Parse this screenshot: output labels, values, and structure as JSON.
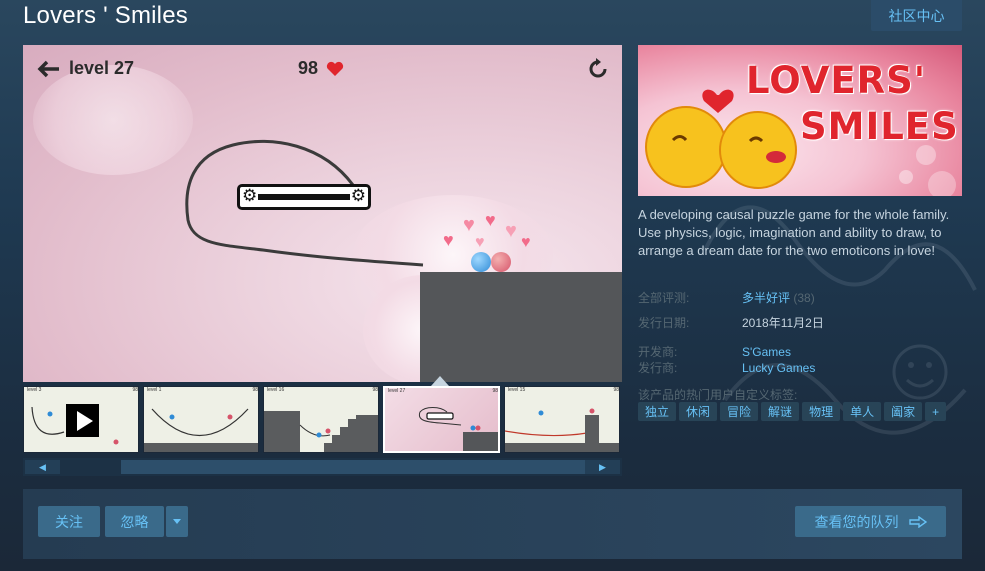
{
  "app": {
    "title": "Lovers ' Smiles",
    "community_hub": "社区中心"
  },
  "media": {
    "level_label": "level 27",
    "lives": "98",
    "thumb_labels": [
      "level 3",
      "level 1",
      "level 16",
      "level 27",
      "level 15"
    ],
    "thumb_lives": "98"
  },
  "capsule": {
    "line1": "LOVERS'",
    "line2": "SMILES"
  },
  "description": "A developing causal puzzle game for the whole family. Use physics, logic, imagination and ability to draw, to arrange a dream date for the two emoticons in love!",
  "reviews": {
    "label": "全部评测:",
    "summary": "多半好评",
    "count": "(38)"
  },
  "release": {
    "label": "发行日期:",
    "date": "2018年11月2日"
  },
  "developer": {
    "label": "开发商:",
    "name": "S'Games"
  },
  "publisher": {
    "label": "发行商:",
    "name": "Lucky Games"
  },
  "tags": {
    "label": "该产品的热门用户自定义标签:",
    "items": [
      "独立",
      "休闲",
      "冒险",
      "解谜",
      "物理",
      "单人",
      "阖家",
      "+"
    ]
  },
  "actions": {
    "follow": "关注",
    "ignore": "忽略",
    "queue": "查看您的队列"
  },
  "colors": {
    "accent": "#67c1f5",
    "heart": "#e0252d"
  }
}
